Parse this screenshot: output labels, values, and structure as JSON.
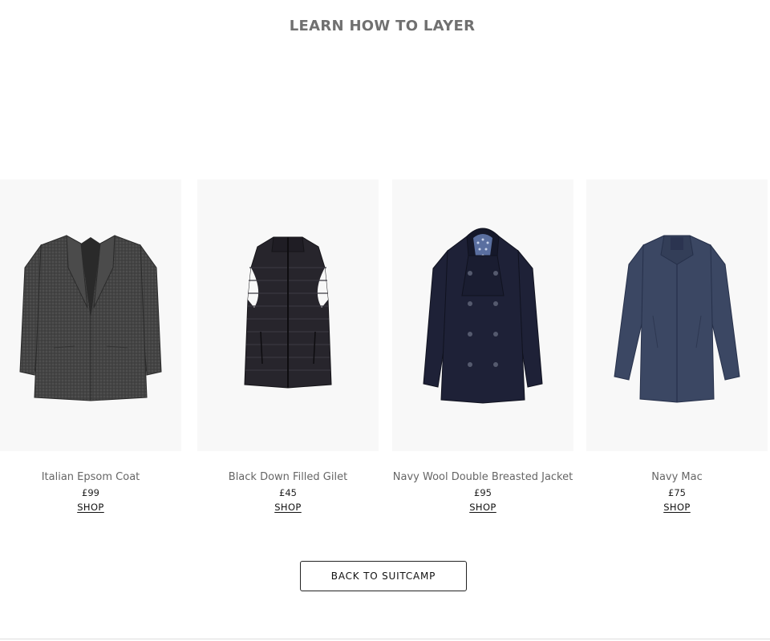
{
  "page": {
    "title": "LEARN HOW TO LAYER"
  },
  "products": [
    {
      "name": "Italian Epsom Coat",
      "price": "£99",
      "shop_label": "SHOP",
      "image": "grey-overcoat-image",
      "color": "#3f3f3f"
    },
    {
      "name": "Black Down Filled Gilet",
      "price": "£45",
      "shop_label": "SHOP",
      "image": "black-gilet-image",
      "color": "#24222a"
    },
    {
      "name": "Navy Wool Double Breasted Jacket",
      "price": "£95",
      "shop_label": "SHOP",
      "image": "navy-peacoat-image",
      "color": "#1e2137"
    },
    {
      "name": "Navy Mac",
      "price": "£75",
      "shop_label": "SHOP",
      "image": "navy-mac-image",
      "color": "#3b4763"
    }
  ],
  "footer": {
    "back_label": "BACK TO SUITCAMP"
  }
}
